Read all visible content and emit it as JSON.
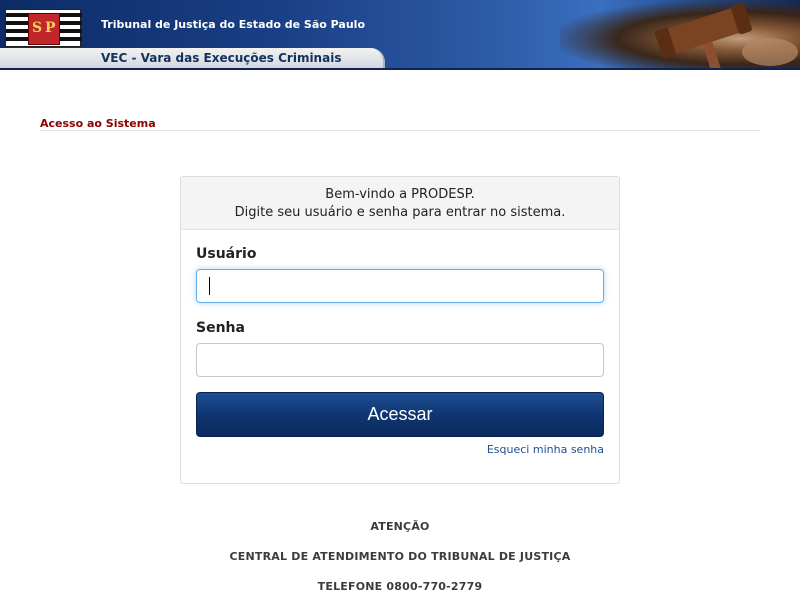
{
  "header": {
    "court_name": "Tribunal de Justiça do Estado de São Paulo",
    "system_name": "VEC - Vara das Execuções Criminais",
    "logo_letters": [
      "S",
      "P"
    ]
  },
  "section": {
    "title": "Acesso ao Sistema"
  },
  "login": {
    "welcome_line1": "Bem-vindo a PRODESP.",
    "welcome_line2": "Digite seu usuário e senha para entrar no sistema.",
    "username_label": "Usuário",
    "username_value": "",
    "password_label": "Senha",
    "password_value": "",
    "submit_label": "Acessar",
    "forgot_label": "Esqueci minha senha"
  },
  "notice": {
    "line1": "ATENÇÃO",
    "line2": "CENTRAL DE ATENDIMENTO DO TRIBUNAL DE JUSTIÇA",
    "line3": "TELEFONE 0800-770-2779"
  },
  "colors": {
    "banner": "#1a3f86",
    "accent_label": "#8b0000",
    "button": "#0f3470",
    "link": "#1f4f8f"
  },
  "icons": {
    "logo": "sp-coat-of-arms-icon",
    "banner_art": "gavel-icon"
  }
}
